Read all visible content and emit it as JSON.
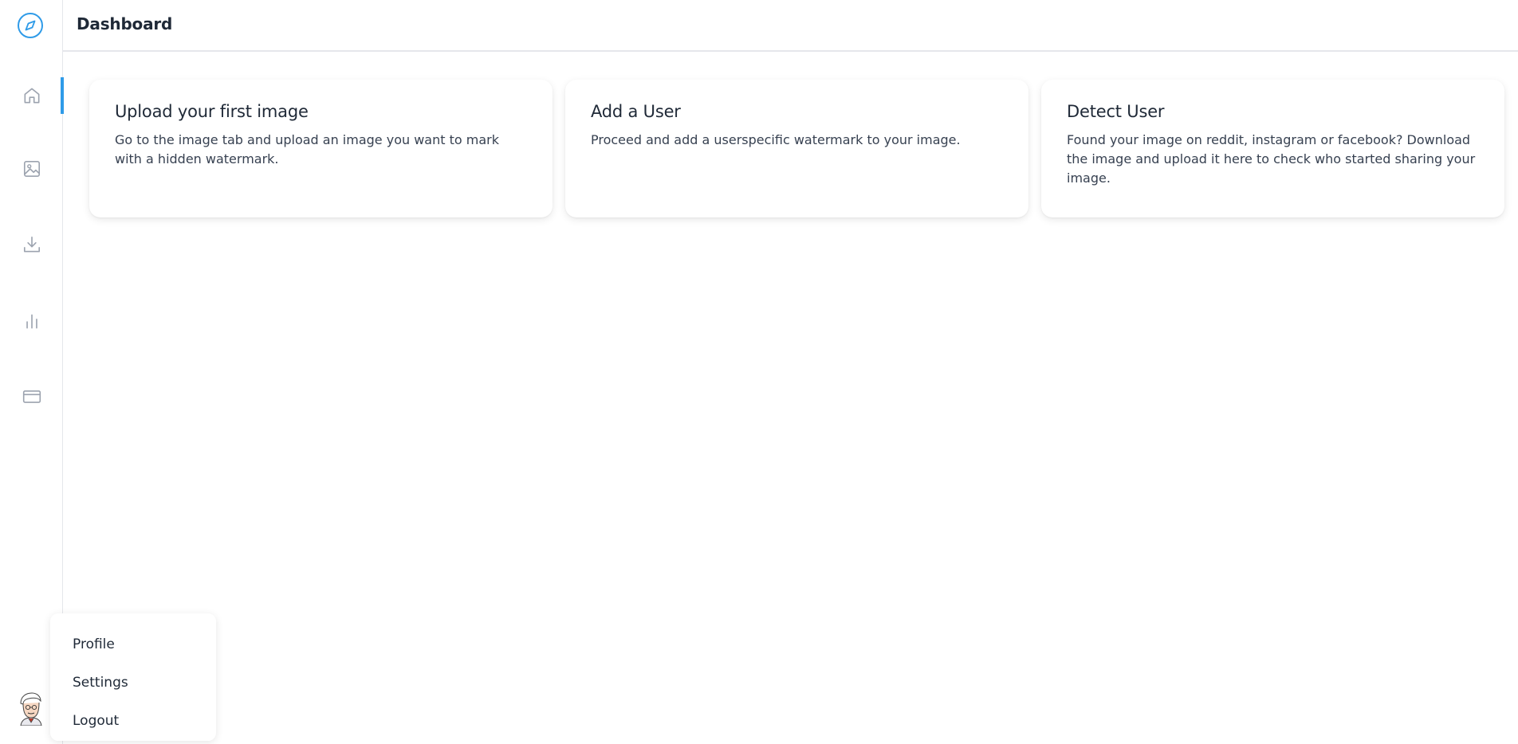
{
  "header": {
    "title": "Dashboard"
  },
  "sidebar": {
    "logo_icon": "compass-icon",
    "items": [
      {
        "icon": "home-icon",
        "active": true
      },
      {
        "icon": "image-icon",
        "active": false
      },
      {
        "icon": "download-icon",
        "active": false
      },
      {
        "icon": "bar-chart-icon",
        "active": false
      },
      {
        "icon": "credit-card-icon",
        "active": false
      }
    ]
  },
  "cards": [
    {
      "title": "Upload your first image",
      "text": "Go to the image tab and upload an image you want to mark with a hidden watermark."
    },
    {
      "title": "Add a User",
      "text": "Proceed and add a userspecific watermark to your image."
    },
    {
      "title": "Detect User",
      "text": "Found your image on reddit, instagram or facebook? Download the image and upload it here to check who started sharing your image."
    }
  ],
  "user_menu": {
    "items": [
      "Profile",
      "Settings",
      "Logout"
    ]
  },
  "colors": {
    "accent": "#2f9be8",
    "icon": "#9ca3af"
  }
}
